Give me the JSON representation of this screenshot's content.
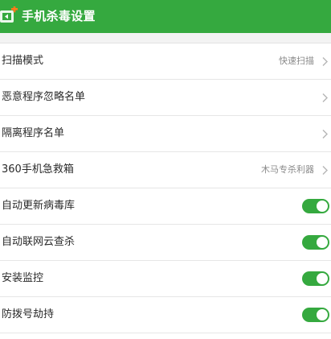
{
  "header": {
    "title": "手机杀毒设置",
    "back_icon": "back-arrow-icon",
    "accent_color": "#35a93f"
  },
  "rows": [
    {
      "label": "扫描模式",
      "value": "快速扫描",
      "type": "link",
      "icon": "chevron-right-icon"
    },
    {
      "label": "恶意程序忽略名单",
      "value": "",
      "type": "link",
      "icon": "chevron-right-icon"
    },
    {
      "label": "隔离程序名单",
      "value": "",
      "type": "link",
      "icon": "chevron-right-icon"
    },
    {
      "label": "360手机急救箱",
      "value": "木马专杀利器",
      "type": "link",
      "icon": "chevron-right-icon"
    },
    {
      "label": "自动更新病毒库",
      "type": "toggle",
      "on": true
    },
    {
      "label": "自动联网云查杀",
      "type": "toggle",
      "on": true
    },
    {
      "label": "安装监控",
      "type": "toggle",
      "on": true
    },
    {
      "label": "防拨号劫持",
      "type": "toggle",
      "on": true
    }
  ]
}
